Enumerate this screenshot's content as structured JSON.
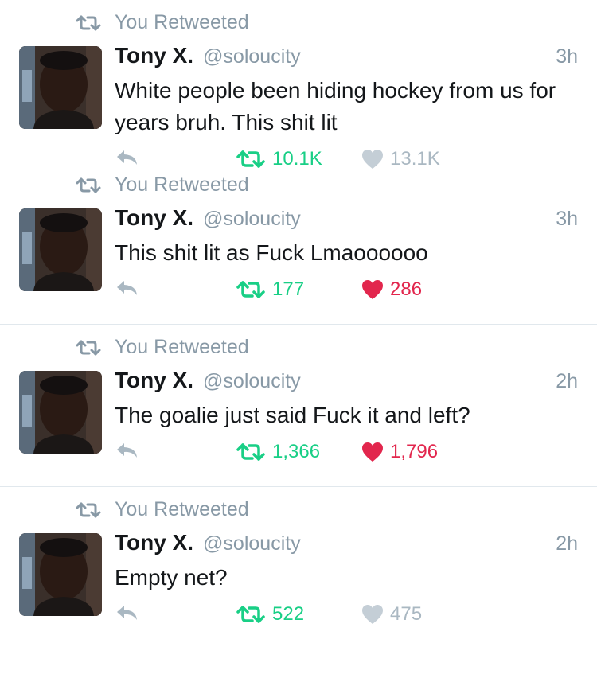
{
  "colors": {
    "retweet_green": "#19cf86",
    "like_red": "#e2264d",
    "muted_gray": "#8899a6",
    "text": "#14171a"
  },
  "tweets": [
    {
      "context": "You Retweeted",
      "name": "Tony X.",
      "handle": "@soloucity",
      "time": "3h",
      "text": "White people been hiding hockey from us for years bruh. This shit lit",
      "retweets": "10.1K",
      "likes": "13.1K",
      "liked": false,
      "icons": {
        "context": "retweet-icon",
        "reply": "reply-icon",
        "retweet": "retweet-icon",
        "like": "heart-icon"
      }
    },
    {
      "context": "You Retweeted",
      "name": "Tony X.",
      "handle": "@soloucity",
      "time": "3h",
      "text": "This shit lit as Fuck Lmaoooooo",
      "retweets": "177",
      "likes": "286",
      "liked": true,
      "icons": {
        "context": "retweet-icon",
        "reply": "reply-icon",
        "retweet": "retweet-icon",
        "like": "heart-icon"
      }
    },
    {
      "context": "You Retweeted",
      "name": "Tony X.",
      "handle": "@soloucity",
      "time": "2h",
      "text": "The goalie just said Fuck it and left?",
      "retweets": "1,366",
      "likes": "1,796",
      "liked": true,
      "icons": {
        "context": "retweet-icon",
        "reply": "reply-icon",
        "retweet": "retweet-icon",
        "like": "heart-icon"
      }
    },
    {
      "context": "You Retweeted",
      "name": "Tony X.",
      "handle": "@soloucity",
      "time": "2h",
      "text": "Empty net?",
      "retweets": "522",
      "likes": "475",
      "liked": false,
      "icons": {
        "context": "retweet-icon",
        "reply": "reply-icon",
        "retweet": "retweet-icon",
        "like": "heart-icon"
      }
    }
  ]
}
